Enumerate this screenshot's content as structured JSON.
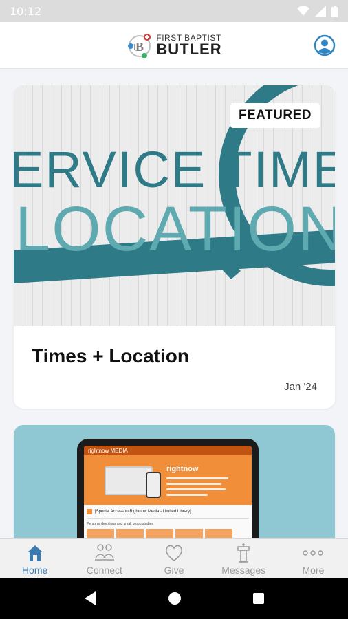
{
  "status_bar": {
    "time": "10:12"
  },
  "header": {
    "logo_top": "FIRST BAPTIST",
    "logo_bottom": "BUTLER"
  },
  "featured_card": {
    "badge": "FEATURED",
    "image_line_1": "ERVICE TIME",
    "image_line_2": "LOCATION",
    "title": "Times + Location",
    "date": "Jan '24"
  },
  "second_card": {
    "screen_topbar": "rightnow MEDIA",
    "screen_brand": "rightnow",
    "screen_access": "[Special Access to Rightnow Media - Limited Library]",
    "screen_sub": "Personal devotions and small group studies"
  },
  "bottom_nav": {
    "items": [
      {
        "label": "Home",
        "icon": "home-icon",
        "active": true
      },
      {
        "label": "Connect",
        "icon": "people-icon",
        "active": false
      },
      {
        "label": "Give",
        "icon": "heart-icon",
        "active": false
      },
      {
        "label": "Messages",
        "icon": "pulpit-icon",
        "active": false
      },
      {
        "label": "More",
        "icon": "more-dots-icon",
        "active": false
      }
    ]
  },
  "colors": {
    "accent": "#3a7ab0",
    "teal": "#2e7a86",
    "light_teal": "#5eaab0",
    "nav_inactive": "#9a9a9a"
  }
}
